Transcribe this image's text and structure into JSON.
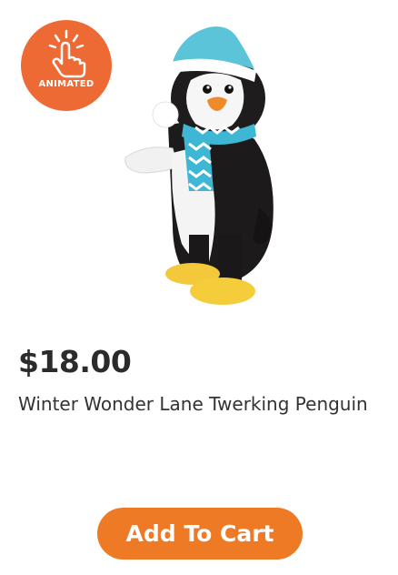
{
  "badge": {
    "label": "ANIMATED",
    "icon": "tap-hand-icon",
    "color": "#ee6a35"
  },
  "product": {
    "image": "penguin-plush-image",
    "price": "$18.00",
    "title": "Winter Wonder Lane Twerking Penguin"
  },
  "actions": {
    "add_to_cart_label": "Add To Cart",
    "button_color": "#ee7a26"
  }
}
